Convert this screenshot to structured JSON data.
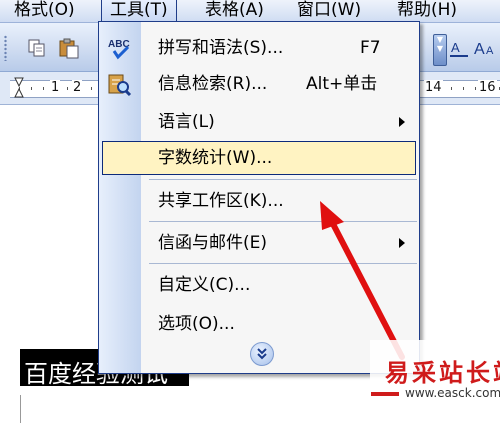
{
  "menubar": {
    "items": [
      {
        "label": "格式(O)"
      },
      {
        "label": "工具(T)"
      },
      {
        "label": "表格(A)"
      },
      {
        "label": "窗口(W)"
      },
      {
        "label": "帮助(H)"
      }
    ],
    "open_index": 1
  },
  "ruler": {
    "numbers": [
      "1",
      "2",
      "14",
      "16"
    ]
  },
  "menu": {
    "items": [
      {
        "label": "拼写和语法(S)...",
        "shortcut": "F7",
        "icon": "spelling-check-icon"
      },
      {
        "label": "信息检索(R)...",
        "shortcut": "Alt+单击",
        "icon": "research-icon"
      },
      {
        "label": "语言(L)",
        "submenu": true
      },
      {
        "label": "字数统计(W)...",
        "highlighted": true
      },
      {
        "label": "共享工作区(K)..."
      },
      {
        "label": "信函与邮件(E)",
        "submenu": true
      },
      {
        "label": "自定义(C)..."
      },
      {
        "label": "选项(O)..."
      }
    ],
    "expand_icon": "chevron-double-down-icon"
  },
  "document": {
    "text": "百度经验测试"
  },
  "watermark": {
    "title": "易采站长站",
    "url": "www.easck.com"
  },
  "colors": {
    "menu_highlight": "#fff3c2",
    "menu_border": "#1f3d8a",
    "arrow": "#e01010",
    "watermark": "#cf1b1b"
  }
}
